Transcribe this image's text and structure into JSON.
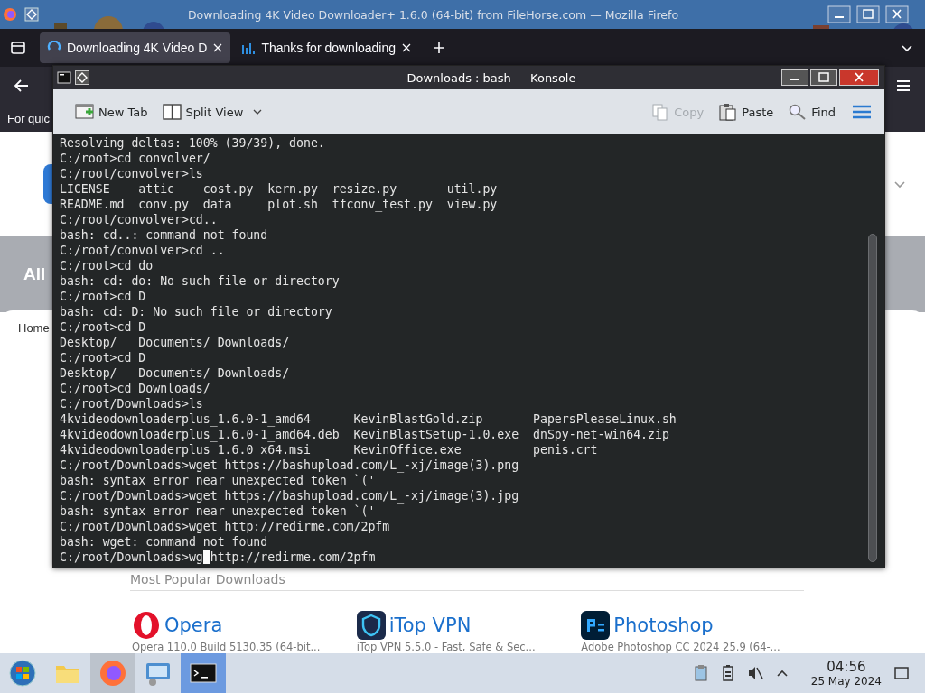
{
  "browser": {
    "title": "Downloading 4K Video Downloader+ 1.6.0 (64-bit) from FileHorse.com — Mozilla Firefo",
    "tabs": [
      {
        "label": "Downloading 4K Video D",
        "selected": true,
        "kind": "spinner"
      },
      {
        "label": "Thanks for downloading",
        "selected": false,
        "kind": "chart"
      }
    ],
    "notice": "For quic",
    "page": {
      "heading": "All",
      "breadcrumb": "Home",
      "section": "Most Popular Downloads",
      "apps": [
        {
          "name": "Opera",
          "description": "Opera 110.0 Build 5130.35 (64-bit...",
          "kind": "opera"
        },
        {
          "name": "iTop VPN",
          "description": "iTop VPN 5.5.0 - Fast, Safe & Sec...",
          "kind": "vpn"
        },
        {
          "name": "Photoshop",
          "description": "Adobe Photoshop CC 2024 25.9 (64-...",
          "kind": "ps"
        }
      ]
    }
  },
  "konsole": {
    "title": "Downloads : bash — Konsole",
    "toolbar_left": [
      {
        "label": "New Tab",
        "kind": "newtab",
        "disabled": false
      },
      {
        "label": "Split View",
        "kind": "split",
        "disabled": false
      }
    ],
    "toolbar_right": [
      {
        "label": "Copy",
        "kind": "copy",
        "disabled": true
      },
      {
        "label": "Paste",
        "kind": "paste",
        "disabled": false
      },
      {
        "label": "Find",
        "kind": "find",
        "disabled": false
      }
    ],
    "lines": [
      "Resolving deltas: 100% (39/39), done.",
      "C:/root>cd convolver/",
      "C:/root/convolver>ls",
      "LICENSE    attic    cost.py  kern.py  resize.py       util.py",
      "README.md  conv.py  data     plot.sh  tfconv_test.py  view.py",
      "C:/root/convolver>cd..",
      "bash: cd..: command not found",
      "C:/root/convolver>cd ..",
      "C:/root>cd do",
      "bash: cd: do: No such file or directory",
      "C:/root>cd D",
      "bash: cd: D: No such file or directory",
      "C:/root>cd D",
      "Desktop/   Documents/ Downloads/",
      "C:/root>cd D",
      "Desktop/   Documents/ Downloads/",
      "C:/root>cd Downloads/",
      "C:/root/Downloads>ls",
      "4kvideodownloaderplus_1.6.0-1_amd64      KevinBlastGold.zip       PapersPleaseLinux.sh",
      "4kvideodownloaderplus_1.6.0-1_amd64.deb  KevinBlastSetup-1.0.exe  dnSpy-net-win64.zip",
      "4kvideodownloaderplus_1.6.0_x64.msi      KevinOffice.exe          penis.crt",
      "C:/root/Downloads>wget https://bashupload.com/L_-xj/image(3).png",
      "bash: syntax error near unexpected token `('",
      "C:/root/Downloads>wget https://bashupload.com/L_-xj/image(3).jpg",
      "bash: syntax error near unexpected token `('",
      "C:/root/Downloads>wget http://redirme.com/2pfm",
      "bash: wget: command not found"
    ],
    "prompt": {
      "before_cursor": "C:/root/Downloads>wg",
      "after_cursor": "http://redirme.com/2pfm"
    }
  },
  "taskbar": {
    "items": [
      {
        "kind": "start",
        "hovered": false,
        "selected": false
      },
      {
        "kind": "files",
        "hovered": false,
        "selected": false
      },
      {
        "kind": "firefox",
        "hovered": true,
        "selected": false
      },
      {
        "kind": "monitor",
        "hovered": false,
        "selected": false
      },
      {
        "kind": "terminal",
        "hovered": false,
        "selected": true
      }
    ],
    "time": "04:56",
    "date": "25 May 2024"
  }
}
